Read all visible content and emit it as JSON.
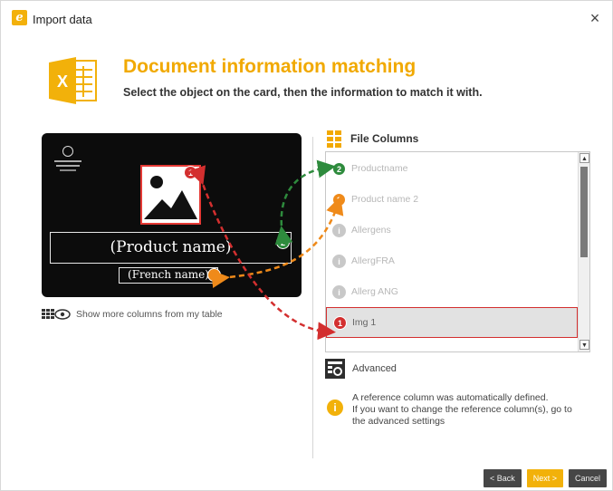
{
  "window": {
    "title": "Import data",
    "close_glyph": "×"
  },
  "header": {
    "title": "Document information matching",
    "subtitle": "Select the object on the card, then the information to match it with."
  },
  "card": {
    "product_name_placeholder": "(Product name)",
    "french_name_placeholder": "(French name)",
    "badges": {
      "image": "1",
      "product_name": "2",
      "french_name": "3"
    }
  },
  "show_more": {
    "label": "Show more columns from my table"
  },
  "file_columns": {
    "title": "File Columns",
    "items": [
      {
        "label": "Productname",
        "badge": "2",
        "badge_color": "#2e8b3d",
        "selected": false
      },
      {
        "label": "Product name 2",
        "badge": "3",
        "badge_color": "#ef8a1a",
        "selected": false
      },
      {
        "label": "Allergens",
        "badge": "i",
        "badge_color": "#c8c8c8",
        "selected": false
      },
      {
        "label": "AllergFRA",
        "badge": "i",
        "badge_color": "#c8c8c8",
        "selected": false
      },
      {
        "label": "Allerg ANG",
        "badge": "i",
        "badge_color": "#c8c8c8",
        "selected": false
      },
      {
        "label": "Img 1",
        "badge": "1",
        "badge_color": "#d32f2f",
        "selected": true
      }
    ]
  },
  "advanced": {
    "label": "Advanced"
  },
  "info": {
    "line1": "A reference column was automatically defined.",
    "line2": "If you want to change the reference column(s), go to",
    "line3": "the advanced settings"
  },
  "footer": {
    "back_label": "< Back",
    "next_label": "Next >",
    "cancel_label": "Cancel"
  },
  "colors": {
    "accent": "#f2b10a",
    "match1": "#d32f2f",
    "match2": "#2e8b3d",
    "match3": "#ef8a1a"
  }
}
